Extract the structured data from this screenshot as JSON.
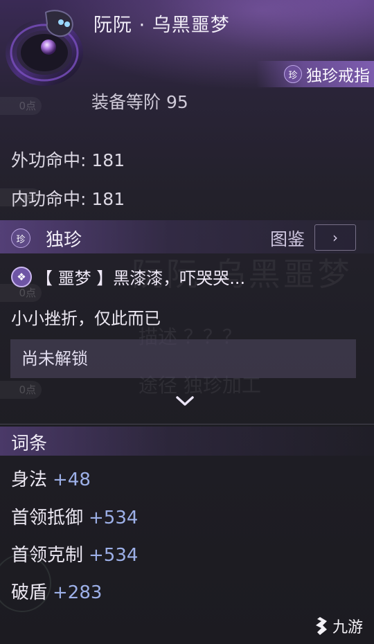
{
  "item": {
    "name": "阮阮 · 乌黑噩梦",
    "rarity_label": "独珍戒指",
    "rarity_icon_char": "珍",
    "tier_label": "装备等阶",
    "tier_value": "95"
  },
  "stats": [
    {
      "label": "外功命中",
      "value": "181"
    },
    {
      "label": "内功命中",
      "value": "181"
    }
  ],
  "unique": {
    "icon_char": "珍",
    "title": "独珍",
    "atlas_label": "图鉴",
    "atlas_arrow": "›",
    "skill_name": "【 噩梦 】黑漆漆，吓哭哭...",
    "description": "小小挫折，仅此而已",
    "locked_text": "尚未解锁",
    "expand_icon": "chevron-down-icon"
  },
  "attributes": {
    "header": "词条",
    "items": [
      {
        "label": "身法",
        "value": "+48"
      },
      {
        "label": "首领抵御",
        "value": "+534"
      },
      {
        "label": "首领克制",
        "value": "+534"
      },
      {
        "label": "破盾",
        "value": "+283"
      }
    ]
  },
  "background_ghost": {
    "title": "阮阮·乌黑噩梦",
    "line1": "描述 ？？？",
    "line2": "途径 独珍加工",
    "side_pills": [
      "0点",
      "0点",
      "0点",
      "0点"
    ]
  },
  "watermark": {
    "text": "九游"
  },
  "colors": {
    "accent": "#8f6cc8",
    "value_blue": "#9db0e8",
    "band_purple": "#6e50a0"
  }
}
